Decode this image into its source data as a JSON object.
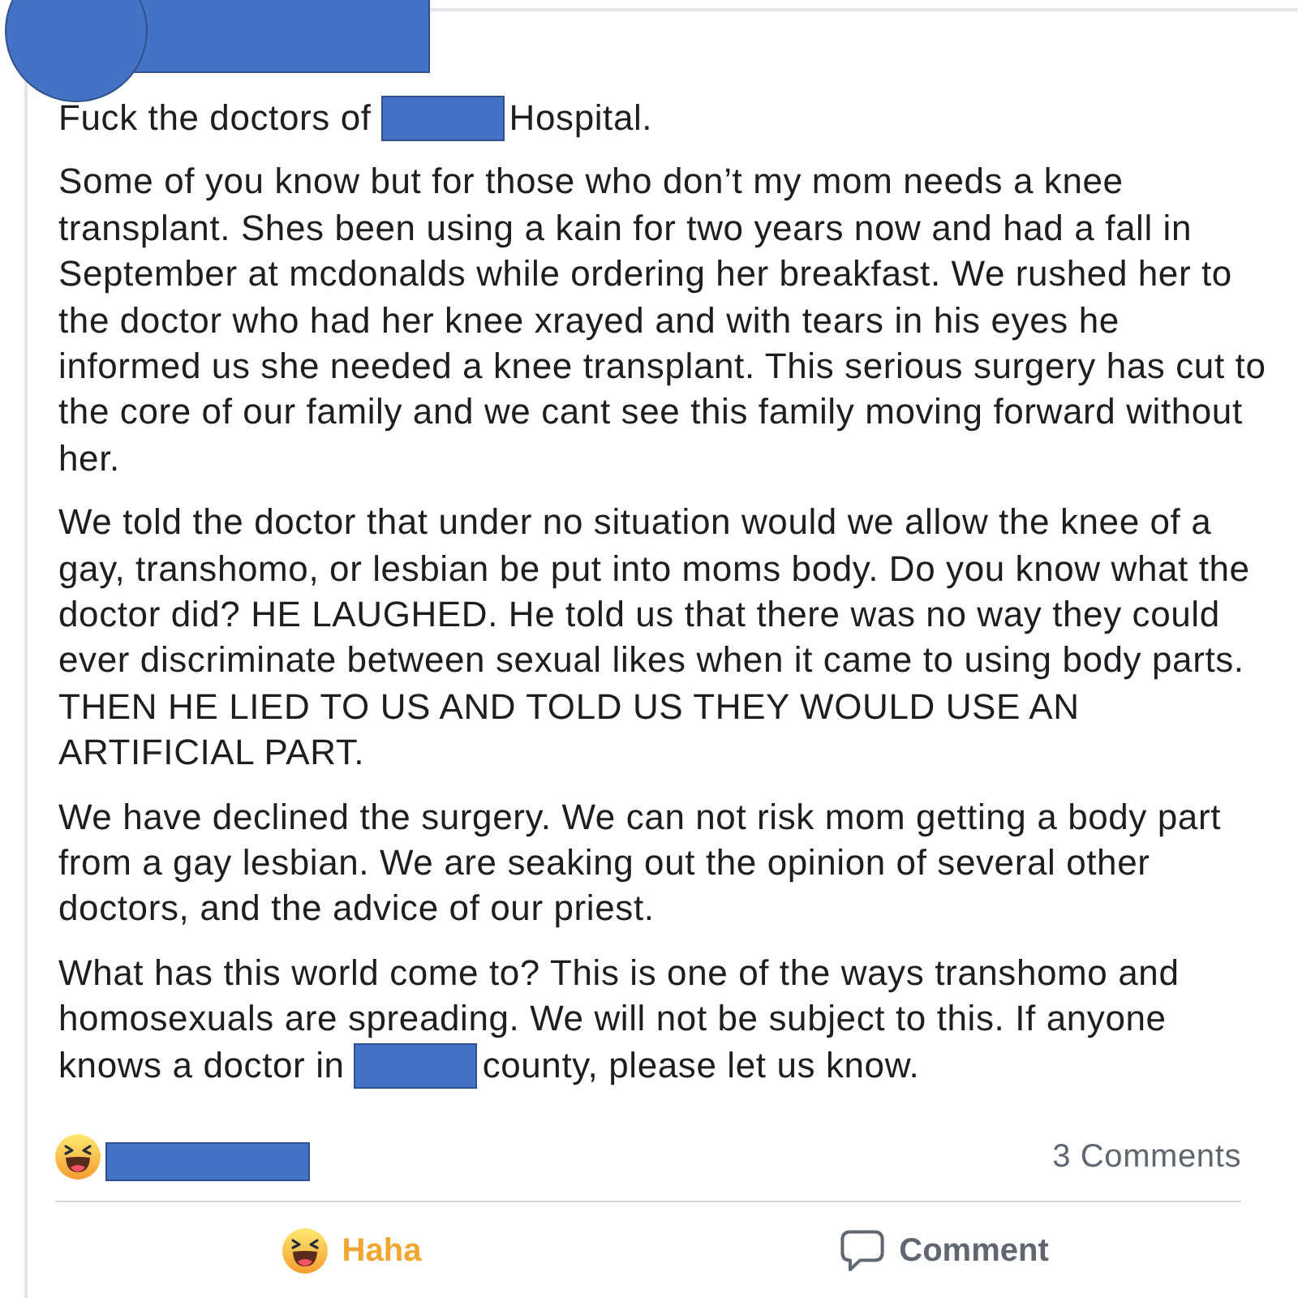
{
  "post": {
    "headline": [
      {
        "kind": "text",
        "text": "Fuck the doctors of"
      },
      {
        "kind": "redaction"
      },
      {
        "kind": "text",
        "text": "Hospital."
      }
    ],
    "paragraphs": [
      {
        "text": "Some of you know but for those who don’t my mom needs a knee transplant. Shes been using a kain for two years now and had a fall in September at mcdonalds while ordering her breakfast. We rushed her to the doctor who had her knee xrayed and with tears in his eyes he informed us she needed a knee transplant. This serious surgery has cut to the core of our family and we cant see this family moving forward without her."
      },
      {
        "text": "We told the doctor that under no situation would we allow the knee of a gay, transhomo, or lesbian be put into moms body. Do you know what the doctor did? HE LAUGHED. He told us that there was no way they could ever discriminate between sexual likes when it came to using body parts. THEN HE LIED TO US AND TOLD US THEY WOULD USE AN ARTIFICIAL PART."
      },
      {
        "text": "We have declined the surgery. We can not risk mom getting a body part from a gay lesbian. We are seaking out the opinion of several other doctors, and the advice of our priest."
      },
      {
        "text": "What has this world come to? This is one of the ways transhomo and homosexuals are spreading. We will not be subject to this. If anyone",
        "last_line": [
          {
            "kind": "text",
            "text": "knows a doctor in"
          },
          {
            "kind": "redaction"
          },
          {
            "kind": "text",
            "text": "county, please let us know."
          }
        ]
      }
    ]
  },
  "footer": {
    "comments": "3 Comments"
  },
  "actions": [
    {
      "kind": "reaction",
      "label": "Haha",
      "selected": true
    },
    {
      "kind": "comment",
      "label": "Comment",
      "selected": false
    }
  ]
}
